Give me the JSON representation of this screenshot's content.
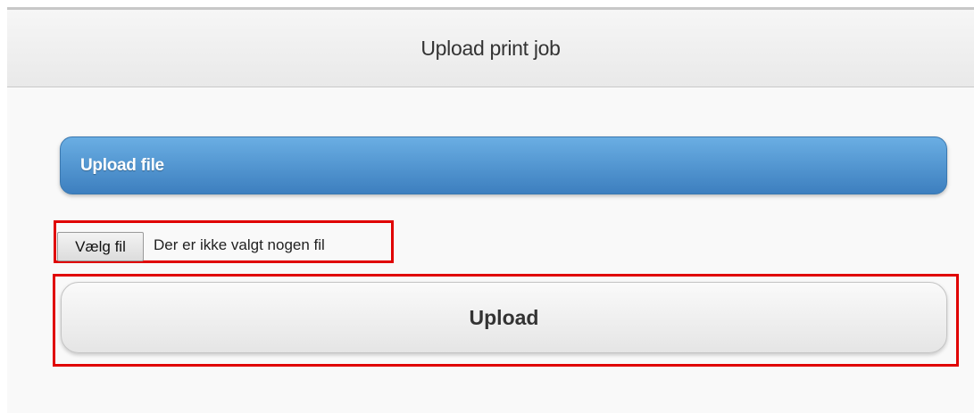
{
  "header": {
    "title": "Upload print job"
  },
  "upload_section": {
    "title": "Upload file",
    "file_input": {
      "button_label": "Vælg fil",
      "status_text": "Der er ikke valgt nogen fil"
    },
    "upload_button_label": "Upload"
  },
  "colors": {
    "section_bar_top": "#6aaee3",
    "section_bar_bottom": "#3d7fbf",
    "highlight_border": "#e00000",
    "page_background": "#f9f9f9"
  }
}
